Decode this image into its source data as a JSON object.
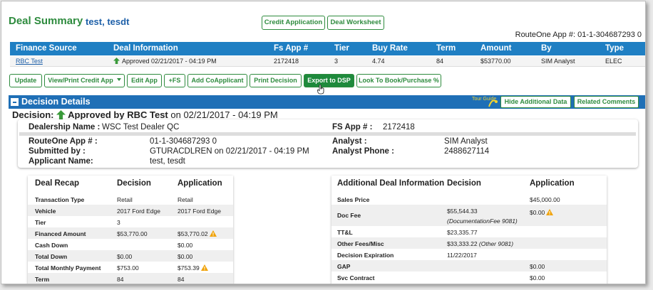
{
  "header": {
    "title": "Deal Summary",
    "customer": "test, tesdt",
    "credit_application_btn": "Credit Application",
    "deal_worksheet_btn": "Deal Worksheet",
    "routeone_app": "RouteOne App #: 01-1-304687293 0"
  },
  "finance_table": {
    "columns": [
      "Finance Source",
      "Deal Information",
      "Fs App #",
      "Tier",
      "Buy Rate",
      "Term",
      "Amount",
      "By",
      "Type"
    ],
    "row": {
      "finance_source": "RBC Test",
      "deal_information": "Approved 02/21/2017 - 04:19 PM",
      "fs_app": "2172418",
      "tier": "3",
      "buy_rate": "4.74",
      "term": "84",
      "amount": "$53770.00",
      "by": "SIM Analyst",
      "type": "ELEC"
    }
  },
  "actions": {
    "update": "Update",
    "view_print": "View/Print Credit App",
    "edit_app": "Edit App",
    "plus_fs": "+FS",
    "add_coapplicant": "Add CoApplicant",
    "print_decision": "Print Decision",
    "export_dsp": "Export to DSP",
    "look_to_book": "Look To Book/Purchase %"
  },
  "decision_details": {
    "title": "Decision Details",
    "tour_guide": "Tour Guide",
    "hide_additional": "Hide Additional Data",
    "related_comments": "Related Comments",
    "decision_prefix": "Decision:",
    "decision_status": "Approved by RBC Test",
    "decision_date": "on 02/21/2017 - 04:19 PM"
  },
  "card": {
    "dealership_label": "Dealership Name :",
    "dealership_value": "WSC Test Dealer QC",
    "fsapp_label": "FS App # :",
    "fsapp_value": "2172418",
    "routeone_label": "RouteOne App # :",
    "routeone_value": "01-1-304687293 0",
    "submitted_label": "Submitted by :",
    "submitted_value": "GTURACDLREN on 02/21/2017 - 04:19 PM",
    "applicant_label": "Applicant Name:",
    "applicant_value": "test, tesdt",
    "analyst_label": "Analyst :",
    "analyst_value": "SIM Analyst",
    "phone_label": "Analyst Phone :",
    "phone_value": "2488627114"
  },
  "deal_recap": {
    "headers": [
      "Deal Recap",
      "Decision",
      "Application"
    ],
    "rows": [
      {
        "label": "Transaction Type",
        "decision": "Retail",
        "application": "Retail"
      },
      {
        "label": "Vehicle",
        "decision": "2017 Ford Edge",
        "application": "2017 Ford Edge"
      },
      {
        "label": "Tier",
        "decision": "3",
        "application": ""
      },
      {
        "label": "Financed Amount",
        "decision": "$53,770.00",
        "application": "$53,770.02"
      },
      {
        "label": "Cash Down",
        "decision": "",
        "application": "$0.00"
      },
      {
        "label": "Total Down",
        "decision": "$0.00",
        "application": "$0.00"
      },
      {
        "label": "Total Monthly Payment",
        "decision": "$753.00",
        "application": "$753.39"
      },
      {
        "label": "Term",
        "decision": "84",
        "application": "84"
      }
    ]
  },
  "additional_info": {
    "headers": [
      "Additional Deal Information",
      "Decision",
      "Application"
    ],
    "rows": [
      {
        "label": "Sales Price",
        "decision": "",
        "decision_note": "",
        "application": "$45,000.00"
      },
      {
        "label": "Doc Fee",
        "decision": "$55,544.33",
        "decision_note": "(DocumentationFee 9081)",
        "application": "$0.00"
      },
      {
        "label": "TT&L",
        "decision": "$23,335.77",
        "decision_note": "",
        "application": ""
      },
      {
        "label": "Other Fees/Misc",
        "decision": "$33,333.22",
        "decision_note": "(Other 9081)",
        "application": ""
      },
      {
        "label": "Decision Expiration",
        "decision": "11/22/2017",
        "decision_note": "",
        "application": ""
      },
      {
        "label": "GAP",
        "decision": "",
        "decision_note": "",
        "application": "$0.00"
      },
      {
        "label": "Svc Contract",
        "decision": "",
        "decision_note": "",
        "application": "$0.00"
      }
    ]
  },
  "colors": {
    "brand_green": "#2e8b3e",
    "header_blue": "#1f7fc3",
    "warning": "#f0a30a"
  }
}
